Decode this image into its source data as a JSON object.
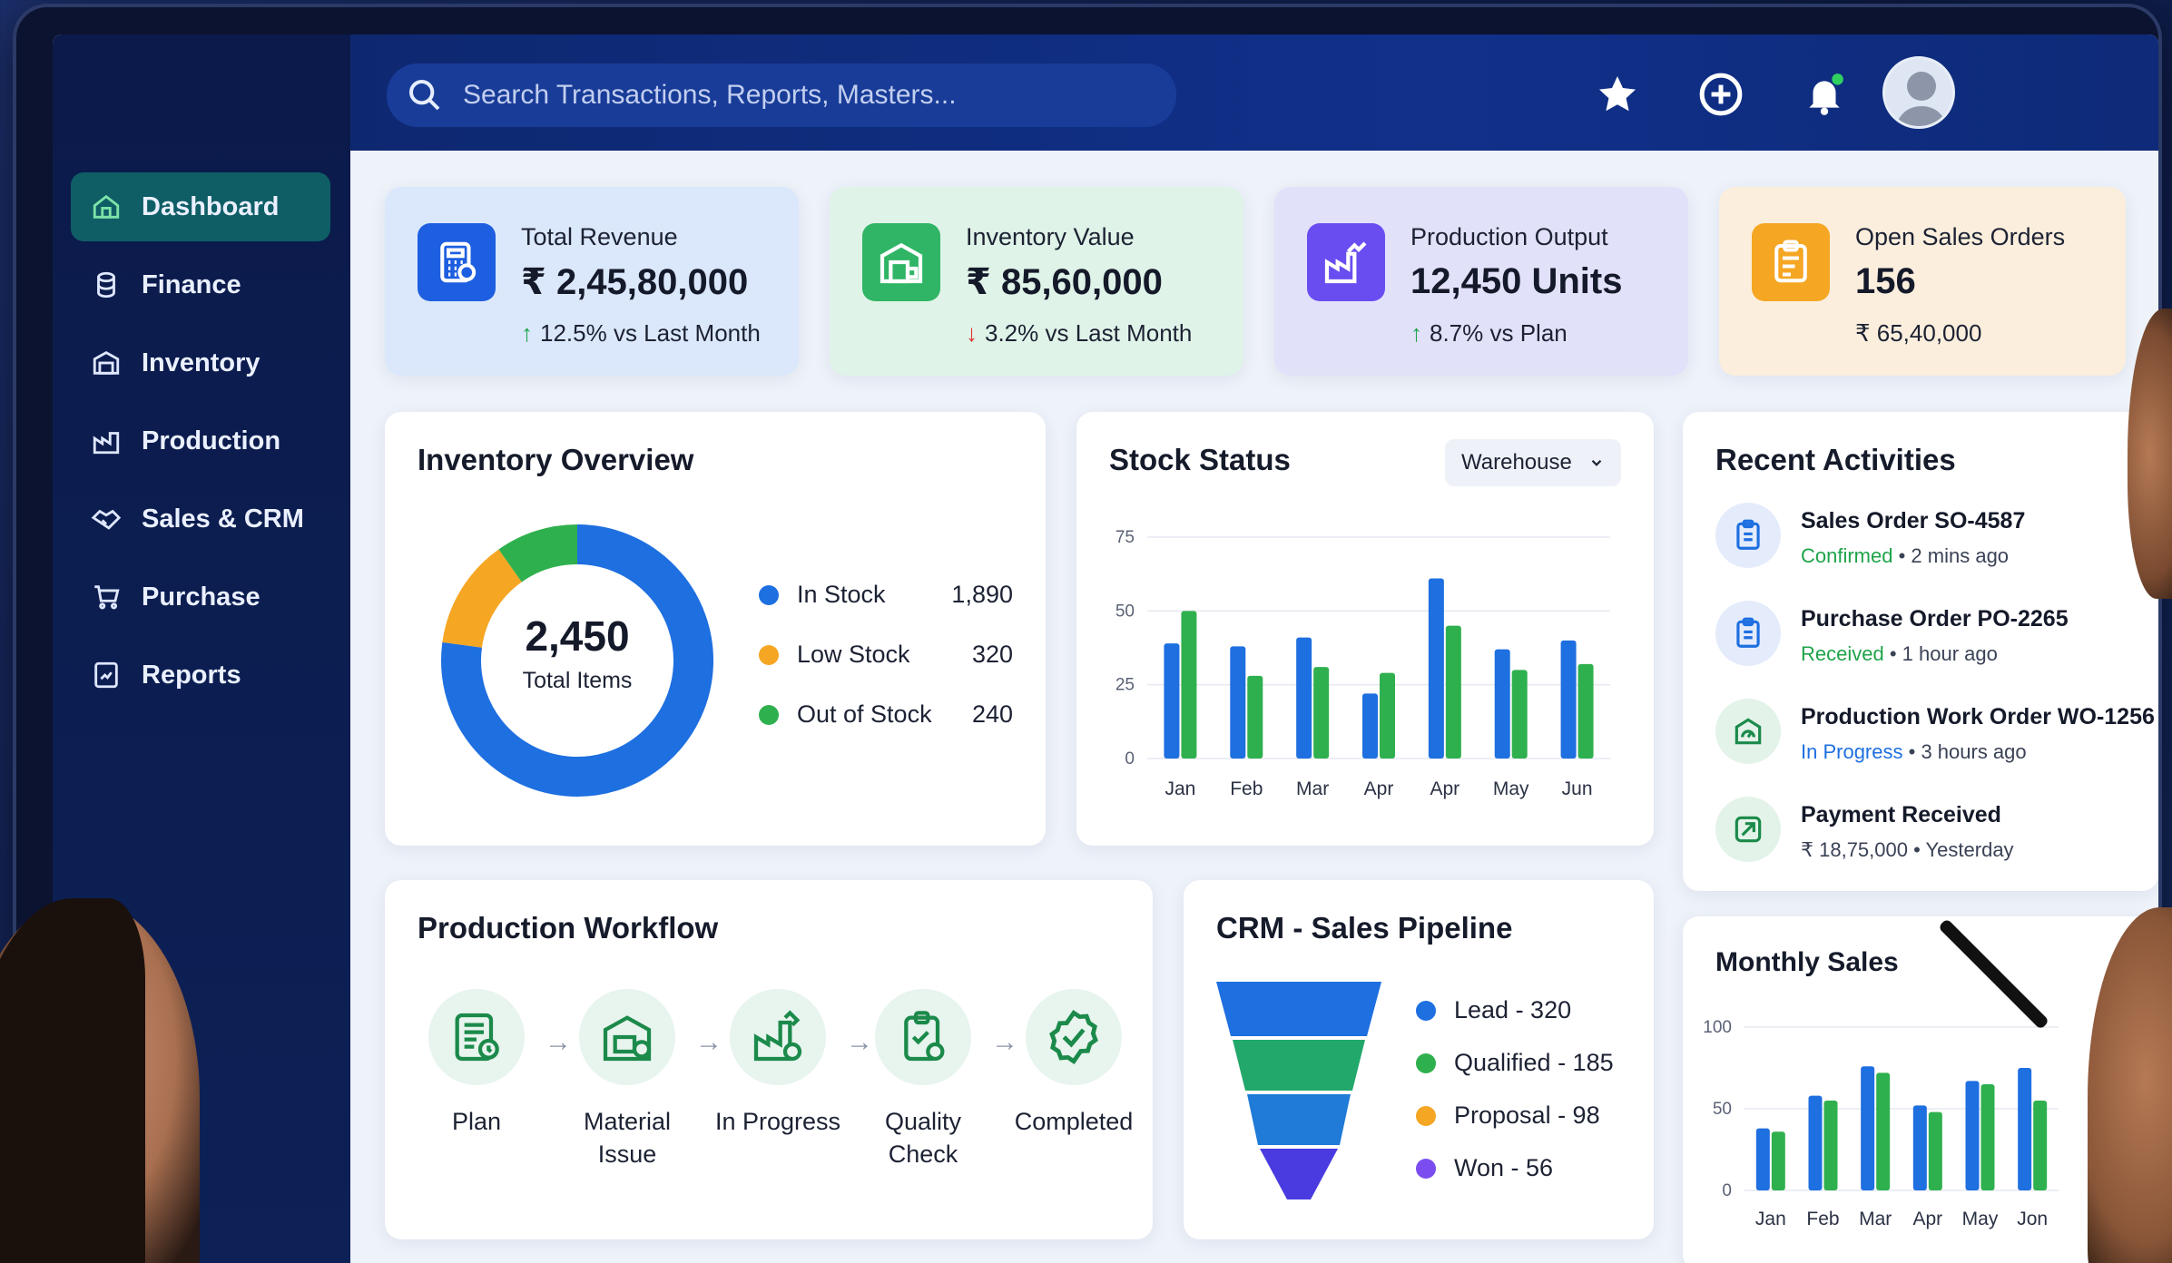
{
  "search": {
    "placeholder": "Search Transactions, Reports, Masters..."
  },
  "sidebar": {
    "items": [
      {
        "label": "Dashboard",
        "icon": "home-icon",
        "active": true
      },
      {
        "label": "Finance",
        "icon": "coins-icon"
      },
      {
        "label": "Inventory",
        "icon": "warehouse-icon"
      },
      {
        "label": "Production",
        "icon": "factory-icon"
      },
      {
        "label": "Sales & CRM",
        "icon": "handshake-icon"
      },
      {
        "label": "Purchase",
        "icon": "cart-icon"
      },
      {
        "label": "Reports",
        "icon": "report-icon"
      }
    ]
  },
  "topbar": {
    "icons": [
      "star-icon",
      "plus-circle-icon",
      "bell-icon",
      "avatar"
    ]
  },
  "kpis": [
    {
      "title": "Total Revenue",
      "value": "₹ 2,45,80,000",
      "trend": "12.5% vs Last Month",
      "trend_dir": "up",
      "icon": "calculator-icon",
      "color": "#1d5fe0"
    },
    {
      "title": "Inventory Value",
      "value": "₹ 85,60,000",
      "trend": "3.2% vs Last Month",
      "trend_dir": "down",
      "icon": "warehouse-icon",
      "color": "#2fb565"
    },
    {
      "title": "Production Output",
      "value": "12,450 Units",
      "trend": "8.7% vs Plan",
      "trend_dir": "up",
      "icon": "factory-chart-icon",
      "color": "#6a4df0"
    },
    {
      "title": "Open Sales Orders",
      "value": "156",
      "trend": "₹ 65,40,000",
      "trend_dir": "none",
      "icon": "clipboard-icon",
      "color": "#f5a623"
    }
  ],
  "inventory_overview": {
    "title": "Inventory Overview",
    "total_value": "2,450",
    "total_label": "Total Items",
    "legend": [
      {
        "label": "In Stock",
        "value": "1,890",
        "color": "#1e6fe0"
      },
      {
        "label": "Low Stock",
        "value": "320",
        "color": "#f5a623"
      },
      {
        "label": "Out of Stock",
        "value": "240",
        "color": "#2fb04e"
      }
    ]
  },
  "stock_status": {
    "title": "Stock Status",
    "filter": "Warehouse"
  },
  "recent_activities": {
    "title": "Recent Activities",
    "items": [
      {
        "title": "Sales Order SO-4587",
        "status": "Confirmed",
        "time": "2 mins ago",
        "icon": "clipboard-icon"
      },
      {
        "title": "Purchase Order PO-2265",
        "status": "Received",
        "time": "1 hour ago",
        "icon": "clipboard-icon"
      },
      {
        "title": "Production Work Order WO-1256",
        "status": "In Progress",
        "time": "3 hours ago",
        "icon": "gauge-icon"
      },
      {
        "title": "Payment Received",
        "status": "₹ 18,75,000",
        "time": "Yesterday",
        "icon": "payment-icon"
      }
    ]
  },
  "production_workflow": {
    "title": "Production Workflow",
    "steps": [
      {
        "label": "Plan",
        "icon": "plan-icon"
      },
      {
        "label": "Material Issue",
        "icon": "material-icon"
      },
      {
        "label": "In Progress",
        "icon": "in-progress-icon"
      },
      {
        "label": "Quality Check",
        "icon": "quality-icon"
      },
      {
        "label": "Completed",
        "icon": "check-icon"
      }
    ]
  },
  "crm_pipeline": {
    "title": "CRM - Sales Pipeline",
    "stages": [
      {
        "label": "Lead - 320",
        "color": "#1e6fe0"
      },
      {
        "label": "Qualified - 185",
        "color": "#2fb04e"
      },
      {
        "label": "Proposal - 98",
        "color": "#f5a623"
      },
      {
        "label": "Won - 56",
        "color": "#7b4df0"
      }
    ]
  },
  "monthly_sales": {
    "title": "Monthly Sales"
  },
  "chart_data": [
    {
      "type": "donut",
      "title": "Inventory Overview",
      "categories": [
        "In Stock",
        "Low Stock",
        "Out of Stock"
      ],
      "values": [
        1890,
        320,
        240
      ],
      "colors": [
        "#1e6fe0",
        "#f5a623",
        "#2fb04e"
      ]
    },
    {
      "type": "bar",
      "title": "Stock Status",
      "categories": [
        "Jan",
        "Feb",
        "Mar",
        "Apr",
        "Apr",
        "May",
        "Jun"
      ],
      "series": [
        {
          "values": [
            39,
            38,
            41,
            22,
            61,
            37,
            40
          ],
          "color": "#1e6fe0"
        },
        {
          "values": [
            50,
            28,
            31,
            29,
            45,
            30,
            32
          ],
          "color": "#2fb04e"
        }
      ],
      "ylim": [
        0,
        75
      ],
      "yticks": [
        0,
        25,
        50,
        75
      ],
      "grid": true
    },
    {
      "type": "bar",
      "title": "Monthly Sales",
      "categories": [
        "Jan",
        "Feb",
        "Mar",
        "Apr",
        "May",
        "Jon"
      ],
      "series": [
        {
          "values": [
            38,
            58,
            76,
            52,
            67,
            75
          ],
          "color": "#1e6fe0"
        },
        {
          "values": [
            36,
            55,
            72,
            48,
            65,
            55
          ],
          "color": "#2fb04e"
        }
      ],
      "ylim": [
        0,
        100
      ],
      "yticks": [
        0,
        50,
        100
      ],
      "grid": true
    }
  ]
}
